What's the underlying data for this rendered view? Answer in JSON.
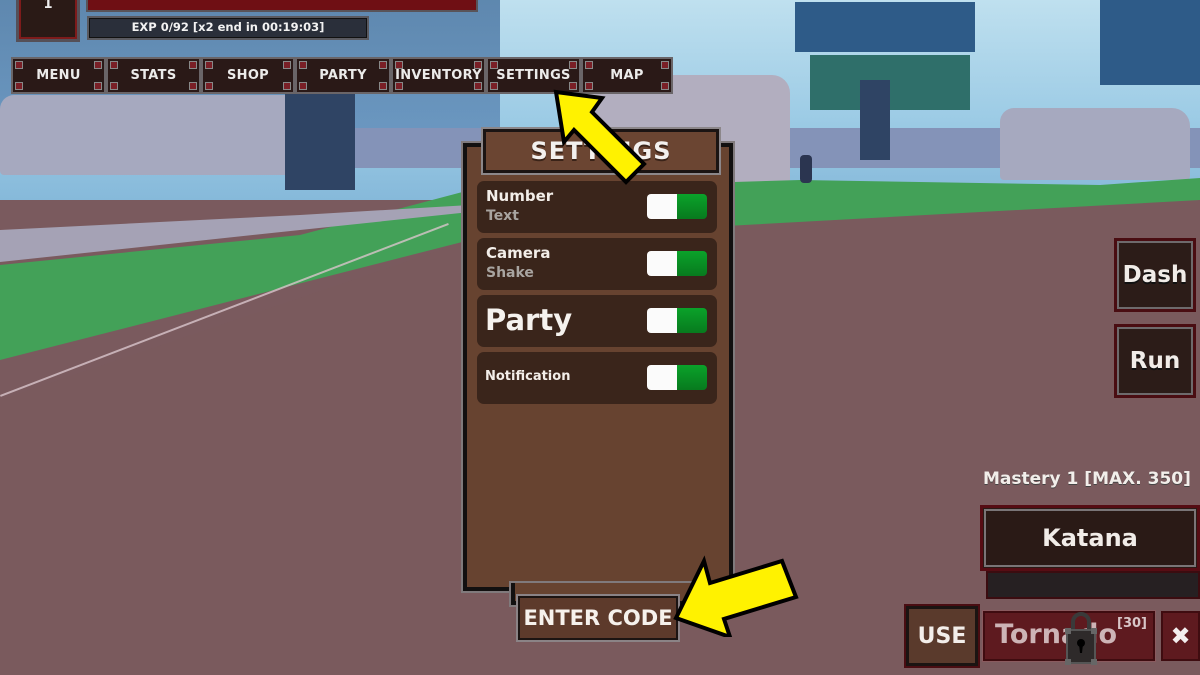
{
  "hud": {
    "level": "1",
    "exp_text": "EXP 0/92 [x2 end in 00:19:03]"
  },
  "menu_bar": {
    "items": [
      {
        "label": "MENU"
      },
      {
        "label": "STATS"
      },
      {
        "label": "SHOP"
      },
      {
        "label": "PARTY"
      },
      {
        "label": "INVENTORY"
      },
      {
        "label": "SETTINGS"
      },
      {
        "label": "MAP"
      }
    ]
  },
  "settings": {
    "title": "SETTINGS",
    "rows": [
      {
        "line1": "Number",
        "line2": "Text",
        "toggle": "on"
      },
      {
        "line1": "Camera",
        "line2": "Shake",
        "toggle": "on"
      },
      {
        "label": "Party",
        "toggle": "on"
      },
      {
        "label": "Notification",
        "toggle": "on"
      }
    ],
    "enter_code_label": "ENTER CODE"
  },
  "side_buttons": {
    "dash": "Dash",
    "run": "Run"
  },
  "weapon": {
    "mastery": "Mastery 1 [MAX. 350]",
    "name": "Katana"
  },
  "skill_bar": {
    "use_label": "USE",
    "skill_name": "Tornado",
    "skill_level": "[30]",
    "locked": true,
    "close_label": "✖"
  },
  "annotations": {
    "arrow_color": "#ffee00",
    "arrow_outline": "#000000"
  }
}
